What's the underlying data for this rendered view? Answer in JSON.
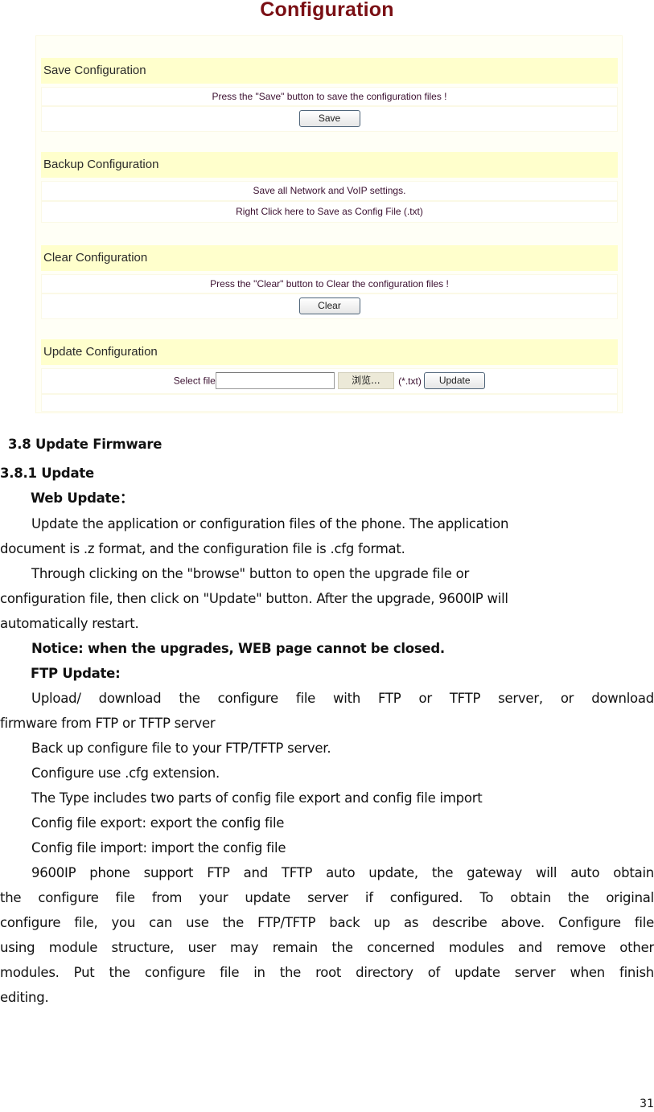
{
  "screenshot": {
    "title": "Configuration",
    "sections": [
      {
        "heading": "Save Configuration",
        "message": "Press the \"Save\" button to save the configuration files !",
        "button_label": "Save"
      },
      {
        "heading": "Backup Configuration",
        "message": "Save all Network and VoIP settings.",
        "link_text": "Right Click here to Save as Config File (.txt)"
      },
      {
        "heading": "Clear Configuration",
        "message": "Press the \"Clear\" button to Clear the configuration files !",
        "button_label": "Clear"
      },
      {
        "heading": "Update Configuration",
        "select_file_label": "Select file",
        "file_input_value": "",
        "browse_button_label": "浏览...",
        "file_type_hint": "(*.txt)",
        "button_label": "Update"
      }
    ]
  },
  "document": {
    "heading_section": "3.8 Update Firmware",
    "heading_subsection": "3.8.1 Update",
    "web_update_heading": "Web Update：",
    "web_update_p1_line1": "Update the application or configuration files of the phone. The application",
    "web_update_p1_line2": "document is .z format, and the configuration file is .cfg format.",
    "web_update_p2_line1": "Through clicking on the \"browse\" button to open the upgrade file or",
    "web_update_p2_line2": "configuration file, then click on \"Update\" button. After the upgrade, 9600IP will",
    "web_update_p2_line3": "automatically restart.",
    "notice": "Notice: when the upgrades, WEB page cannot be closed.",
    "ftp_update_heading": "FTP Update:",
    "ftp_p1_line1": "Upload/ download the configure file with FTP or TFTP server, or download",
    "ftp_p1_line2": "firmware from FTP or TFTP server",
    "ftp_p2": "Back up configure file to your FTP/TFTP server.",
    "ftp_p3": "Configure use .cfg extension.",
    "ftp_p4": "The Type includes two parts of config file export and config file import",
    "ftp_p5": "Config file export: export the config file",
    "ftp_p6": "Config file import: import the config file",
    "auto_p_line1": "9600IP phone support FTP and TFTP auto update, the gateway will auto obtain",
    "auto_p_line2": "the configure file from your update server if configured. To obtain the original",
    "auto_p_line3": "configure file, you can use the FTP/TFTP back up as describe above. Configure file",
    "auto_p_line4": "using module structure, user may remain the concerned modules and remove other",
    "auto_p_line5": "modules. Put the configure file in the root directory of update server when finish",
    "auto_p_line6": "editing."
  },
  "page_number": "31"
}
